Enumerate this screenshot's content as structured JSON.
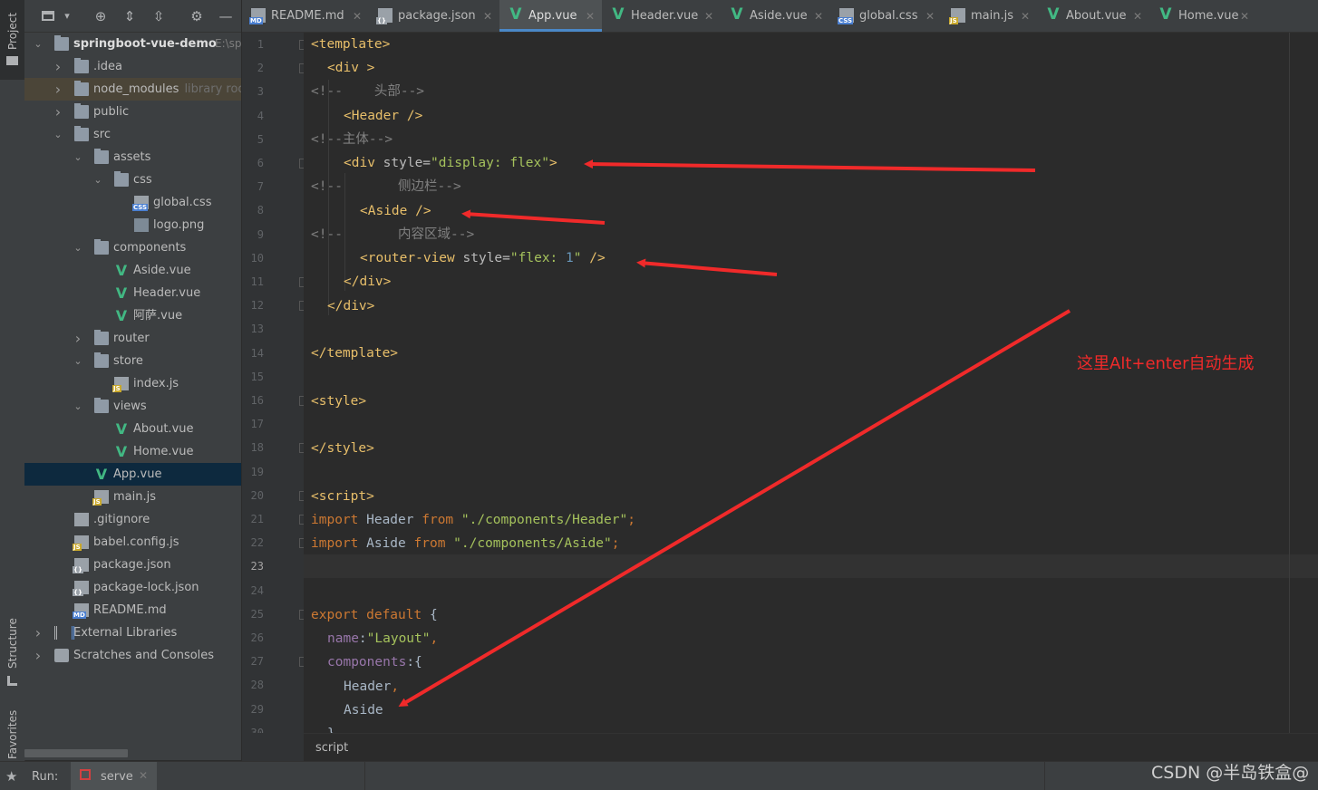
{
  "left_strip": {
    "project_label": "Project",
    "structure_label": "Structure",
    "favorites_label": "Favorites"
  },
  "toolbar_icons": [
    "window-icon",
    "crosshair-icon",
    "expand-all-icon",
    "collapse-all-icon",
    "gear-icon",
    "minimize-icon"
  ],
  "project": {
    "root": {
      "name": "springboot-vue-demo",
      "path_hint": "E:\\sp"
    },
    "items": [
      {
        "label": ".idea",
        "hint": "",
        "type": "folder"
      },
      {
        "label": "node_modules",
        "hint": "library root",
        "type": "folder"
      },
      {
        "label": "public",
        "hint": "",
        "type": "folder"
      },
      {
        "label": "src",
        "hint": "",
        "type": "folder"
      },
      {
        "label": "assets",
        "hint": "",
        "type": "folder"
      },
      {
        "label": "css",
        "hint": "",
        "type": "folder"
      },
      {
        "label": "global.css",
        "hint": "",
        "type": "css"
      },
      {
        "label": "logo.png",
        "hint": "",
        "type": "image"
      },
      {
        "label": "components",
        "hint": "",
        "type": "folder"
      },
      {
        "label": "Aside.vue",
        "hint": "",
        "type": "vue"
      },
      {
        "label": "Header.vue",
        "hint": "",
        "type": "vue"
      },
      {
        "label": "阿萨.vue",
        "hint": "",
        "type": "vue"
      },
      {
        "label": "router",
        "hint": "",
        "type": "folder"
      },
      {
        "label": "store",
        "hint": "",
        "type": "folder"
      },
      {
        "label": "index.js",
        "hint": "",
        "type": "js"
      },
      {
        "label": "views",
        "hint": "",
        "type": "folder"
      },
      {
        "label": "About.vue",
        "hint": "",
        "type": "vue"
      },
      {
        "label": "Home.vue",
        "hint": "",
        "type": "vue"
      },
      {
        "label": "App.vue",
        "hint": "",
        "type": "vue"
      },
      {
        "label": "main.js",
        "hint": "",
        "type": "js"
      },
      {
        "label": ".gitignore",
        "hint": "",
        "type": "file"
      },
      {
        "label": "babel.config.js",
        "hint": "",
        "type": "js"
      },
      {
        "label": "package.json",
        "hint": "",
        "type": "json"
      },
      {
        "label": "package-lock.json",
        "hint": "",
        "type": "json"
      },
      {
        "label": "README.md",
        "hint": "",
        "type": "md"
      },
      {
        "label": "External Libraries",
        "hint": "",
        "type": "lib"
      },
      {
        "label": "Scratches and Consoles",
        "hint": "",
        "type": "scratch"
      }
    ]
  },
  "tabs": [
    {
      "label": "README.md",
      "type": "md"
    },
    {
      "label": "package.json",
      "type": "json"
    },
    {
      "label": "App.vue",
      "type": "vue"
    },
    {
      "label": "Header.vue",
      "type": "vue"
    },
    {
      "label": "Aside.vue",
      "type": "vue"
    },
    {
      "label": "global.css",
      "type": "css"
    },
    {
      "label": "main.js",
      "type": "js"
    },
    {
      "label": "About.vue",
      "type": "vue"
    },
    {
      "label": "Home.vue",
      "type": "vue"
    }
  ],
  "active_tab": "App.vue",
  "line_numbers": [
    "1",
    "2",
    "3",
    "4",
    "5",
    "6",
    "7",
    "8",
    "9",
    "10",
    "11",
    "12",
    "13",
    "14",
    "15",
    "16",
    "17",
    "18",
    "19",
    "20",
    "21",
    "22",
    "23",
    "24",
    "25",
    "26",
    "27",
    "28",
    "29",
    "30"
  ],
  "current_line": "23",
  "code": {
    "l1_tag": "<template>",
    "l2_tag": "<div >",
    "l3_open": "<!--",
    "l3_text": "    头部-->",
    "l4_tag": "<Header />",
    "l5_text": "<!--主体-->",
    "l6_open": "<div ",
    "l6_attr": "style=",
    "l6_q1": "\"",
    "l6_val": "display: flex",
    "l6_q2": "\"",
    "l6_close": ">",
    "l7_open": "<!--",
    "l7_text": "       侧边栏-->",
    "l8_tag": "<Aside />",
    "l9_open": "<!--",
    "l9_text": "       内容区域-->",
    "l10_open": "<router-view ",
    "l10_attr": "style=",
    "l10_q1": "\"",
    "l10_val1": "flex: ",
    "l10_num": "1",
    "l10_q2": "\"",
    "l10_close": " />",
    "l11_tag": "</div>",
    "l12_tag": "</div>",
    "l14_tag": "</template>",
    "l16_tag": "<style>",
    "l18_tag": "</style>",
    "l20_tag": "<script>",
    "l21_kw": "import",
    "l21_name": " Header ",
    "l21_from": "from",
    "l21_str": " \"./components/Header\"",
    "l21_semi": ";",
    "l22_kw": "import",
    "l22_name": " Aside ",
    "l22_from": "from",
    "l22_str": " \"./components/Aside\"",
    "l22_semi": ";",
    "l25_kw": "export default",
    "l25_brace": " {",
    "l26_prop": "name",
    "l26_colon": ":",
    "l26_str": "\"Layout\"",
    "l26_comma": ",",
    "l27_prop": "components",
    "l27_rest": ":{",
    "l28_name": "Header",
    "l28_comma": ",",
    "l29_name": "Aside",
    "l30_text": "}"
  },
  "annotation": "这里Alt+enter自动生成",
  "breadcrumb": "script",
  "run": {
    "label": "Run:",
    "config": "serve"
  },
  "watermark": "CSDN @半岛铁盒@",
  "colors": {
    "annotation_red": "#f02a2a",
    "vue_green": "#42b883",
    "selection_blue": "#0d293e"
  }
}
